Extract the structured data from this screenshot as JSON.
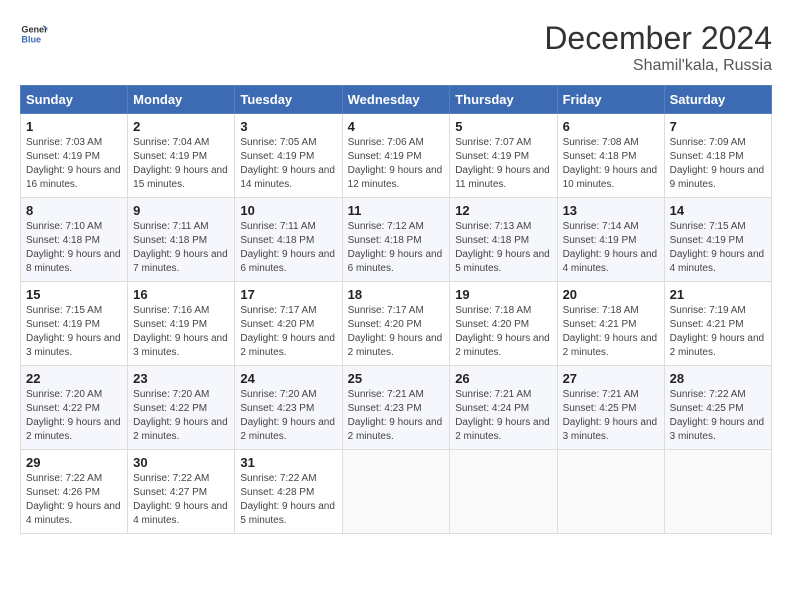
{
  "header": {
    "logo_line1": "General",
    "logo_line2": "Blue",
    "title": "December 2024",
    "subtitle": "Shamil'kala, Russia"
  },
  "weekdays": [
    "Sunday",
    "Monday",
    "Tuesday",
    "Wednesday",
    "Thursday",
    "Friday",
    "Saturday"
  ],
  "weeks": [
    [
      {
        "day": "1",
        "sunrise": "Sunrise: 7:03 AM",
        "sunset": "Sunset: 4:19 PM",
        "daylight": "Daylight: 9 hours and 16 minutes."
      },
      {
        "day": "2",
        "sunrise": "Sunrise: 7:04 AM",
        "sunset": "Sunset: 4:19 PM",
        "daylight": "Daylight: 9 hours and 15 minutes."
      },
      {
        "day": "3",
        "sunrise": "Sunrise: 7:05 AM",
        "sunset": "Sunset: 4:19 PM",
        "daylight": "Daylight: 9 hours and 14 minutes."
      },
      {
        "day": "4",
        "sunrise": "Sunrise: 7:06 AM",
        "sunset": "Sunset: 4:19 PM",
        "daylight": "Daylight: 9 hours and 12 minutes."
      },
      {
        "day": "5",
        "sunrise": "Sunrise: 7:07 AM",
        "sunset": "Sunset: 4:19 PM",
        "daylight": "Daylight: 9 hours and 11 minutes."
      },
      {
        "day": "6",
        "sunrise": "Sunrise: 7:08 AM",
        "sunset": "Sunset: 4:18 PM",
        "daylight": "Daylight: 9 hours and 10 minutes."
      },
      {
        "day": "7",
        "sunrise": "Sunrise: 7:09 AM",
        "sunset": "Sunset: 4:18 PM",
        "daylight": "Daylight: 9 hours and 9 minutes."
      }
    ],
    [
      {
        "day": "8",
        "sunrise": "Sunrise: 7:10 AM",
        "sunset": "Sunset: 4:18 PM",
        "daylight": "Daylight: 9 hours and 8 minutes."
      },
      {
        "day": "9",
        "sunrise": "Sunrise: 7:11 AM",
        "sunset": "Sunset: 4:18 PM",
        "daylight": "Daylight: 9 hours and 7 minutes."
      },
      {
        "day": "10",
        "sunrise": "Sunrise: 7:11 AM",
        "sunset": "Sunset: 4:18 PM",
        "daylight": "Daylight: 9 hours and 6 minutes."
      },
      {
        "day": "11",
        "sunrise": "Sunrise: 7:12 AM",
        "sunset": "Sunset: 4:18 PM",
        "daylight": "Daylight: 9 hours and 6 minutes."
      },
      {
        "day": "12",
        "sunrise": "Sunrise: 7:13 AM",
        "sunset": "Sunset: 4:18 PM",
        "daylight": "Daylight: 9 hours and 5 minutes."
      },
      {
        "day": "13",
        "sunrise": "Sunrise: 7:14 AM",
        "sunset": "Sunset: 4:19 PM",
        "daylight": "Daylight: 9 hours and 4 minutes."
      },
      {
        "day": "14",
        "sunrise": "Sunrise: 7:15 AM",
        "sunset": "Sunset: 4:19 PM",
        "daylight": "Daylight: 9 hours and 4 minutes."
      }
    ],
    [
      {
        "day": "15",
        "sunrise": "Sunrise: 7:15 AM",
        "sunset": "Sunset: 4:19 PM",
        "daylight": "Daylight: 9 hours and 3 minutes."
      },
      {
        "day": "16",
        "sunrise": "Sunrise: 7:16 AM",
        "sunset": "Sunset: 4:19 PM",
        "daylight": "Daylight: 9 hours and 3 minutes."
      },
      {
        "day": "17",
        "sunrise": "Sunrise: 7:17 AM",
        "sunset": "Sunset: 4:20 PM",
        "daylight": "Daylight: 9 hours and 2 minutes."
      },
      {
        "day": "18",
        "sunrise": "Sunrise: 7:17 AM",
        "sunset": "Sunset: 4:20 PM",
        "daylight": "Daylight: 9 hours and 2 minutes."
      },
      {
        "day": "19",
        "sunrise": "Sunrise: 7:18 AM",
        "sunset": "Sunset: 4:20 PM",
        "daylight": "Daylight: 9 hours and 2 minutes."
      },
      {
        "day": "20",
        "sunrise": "Sunrise: 7:18 AM",
        "sunset": "Sunset: 4:21 PM",
        "daylight": "Daylight: 9 hours and 2 minutes."
      },
      {
        "day": "21",
        "sunrise": "Sunrise: 7:19 AM",
        "sunset": "Sunset: 4:21 PM",
        "daylight": "Daylight: 9 hours and 2 minutes."
      }
    ],
    [
      {
        "day": "22",
        "sunrise": "Sunrise: 7:20 AM",
        "sunset": "Sunset: 4:22 PM",
        "daylight": "Daylight: 9 hours and 2 minutes."
      },
      {
        "day": "23",
        "sunrise": "Sunrise: 7:20 AM",
        "sunset": "Sunset: 4:22 PM",
        "daylight": "Daylight: 9 hours and 2 minutes."
      },
      {
        "day": "24",
        "sunrise": "Sunrise: 7:20 AM",
        "sunset": "Sunset: 4:23 PM",
        "daylight": "Daylight: 9 hours and 2 minutes."
      },
      {
        "day": "25",
        "sunrise": "Sunrise: 7:21 AM",
        "sunset": "Sunset: 4:23 PM",
        "daylight": "Daylight: 9 hours and 2 minutes."
      },
      {
        "day": "26",
        "sunrise": "Sunrise: 7:21 AM",
        "sunset": "Sunset: 4:24 PM",
        "daylight": "Daylight: 9 hours and 2 minutes."
      },
      {
        "day": "27",
        "sunrise": "Sunrise: 7:21 AM",
        "sunset": "Sunset: 4:25 PM",
        "daylight": "Daylight: 9 hours and 3 minutes."
      },
      {
        "day": "28",
        "sunrise": "Sunrise: 7:22 AM",
        "sunset": "Sunset: 4:25 PM",
        "daylight": "Daylight: 9 hours and 3 minutes."
      }
    ],
    [
      {
        "day": "29",
        "sunrise": "Sunrise: 7:22 AM",
        "sunset": "Sunset: 4:26 PM",
        "daylight": "Daylight: 9 hours and 4 minutes."
      },
      {
        "day": "30",
        "sunrise": "Sunrise: 7:22 AM",
        "sunset": "Sunset: 4:27 PM",
        "daylight": "Daylight: 9 hours and 4 minutes."
      },
      {
        "day": "31",
        "sunrise": "Sunrise: 7:22 AM",
        "sunset": "Sunset: 4:28 PM",
        "daylight": "Daylight: 9 hours and 5 minutes."
      },
      null,
      null,
      null,
      null
    ]
  ]
}
